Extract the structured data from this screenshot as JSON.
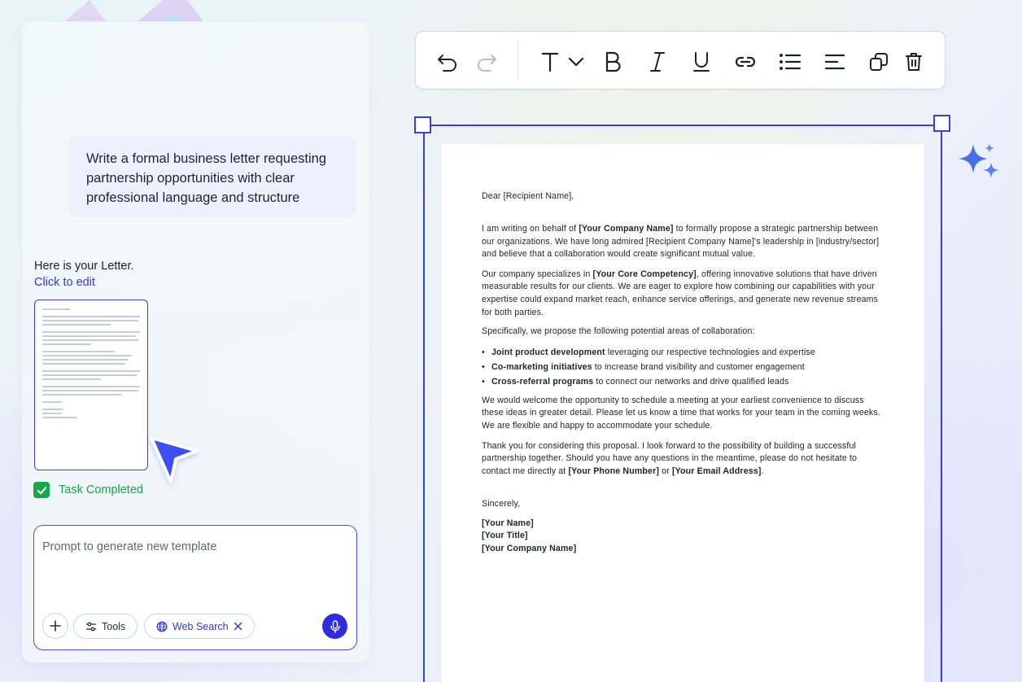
{
  "chat": {
    "prompt_message": "Write a formal business letter requesting partnership opportunities with clear professional language and structure",
    "reply": "Here is your Letter.",
    "edit_link": "Click to edit",
    "status": "Task Completed"
  },
  "composer": {
    "placeholder": "Prompt to generate new template",
    "tools_label": "Tools",
    "web_search_label": "Web Search"
  },
  "toolbar": {
    "icons": [
      "undo-icon",
      "redo-icon",
      "text-style-icon",
      "chevron-down-icon",
      "bold-icon",
      "italic-icon",
      "underline-icon",
      "link-icon",
      "bullet-list-icon",
      "align-left-icon",
      "duplicate-icon",
      "delete-icon"
    ]
  },
  "letter": {
    "salutation": "Dear [Recipient Name],",
    "p1": {
      "a": "I am writing on behalf of ",
      "b": "[Your Company Name]",
      "c": " to formally propose a strategic partnership between our organizations. We have long admired [Recipient Company Name]'s leadership in [industry/sector] and believe that a collaboration would create significant mutual value."
    },
    "p2": {
      "a": "Our company specializes in ",
      "b": "[Your Core Competency]",
      "c": ", offering innovative solutions that have driven measurable results for our clients. We are eager to explore how combining our capabilities with your expertise could expand market reach, enhance service offerings, and generate new revenue streams for both parties."
    },
    "p3": "Specifically, we propose the following potential areas of collaboration:",
    "bullets": [
      {
        "bold": "Joint product development",
        "rest": " leveraging our respective technologies and expertise"
      },
      {
        "bold": "Co-marketing initiatives",
        "rest": " to increase brand visibility and customer engagement"
      },
      {
        "bold": "Cross-referral programs",
        "rest": " to connect our networks and drive qualified leads"
      }
    ],
    "p4": "We would welcome the opportunity to schedule a meeting at your earliest convenience to discuss these ideas in greater detail. Please let us know a time that works for your team in the coming weeks. We are flexible and happy to accommodate your schedule.",
    "p5": {
      "a": "Thank you for considering this proposal. I look forward to the possibility of building a successful partnership together. Should you have any questions in the meantime, please do not hesitate to contact me directly at ",
      "b": "[Your Phone Number]",
      "c": " or ",
      "d": "[Your Email Address]",
      "e": "."
    },
    "closing": "Sincerely,",
    "sign_name": "[Your Name]",
    "sign_title": "[Your Title]",
    "sign_company": "[Your Company Name]"
  },
  "colors": {
    "accent": "#3c3fd6",
    "success": "#17a64a",
    "link": "#3239d8",
    "sparkle": "#4a6ee8"
  }
}
